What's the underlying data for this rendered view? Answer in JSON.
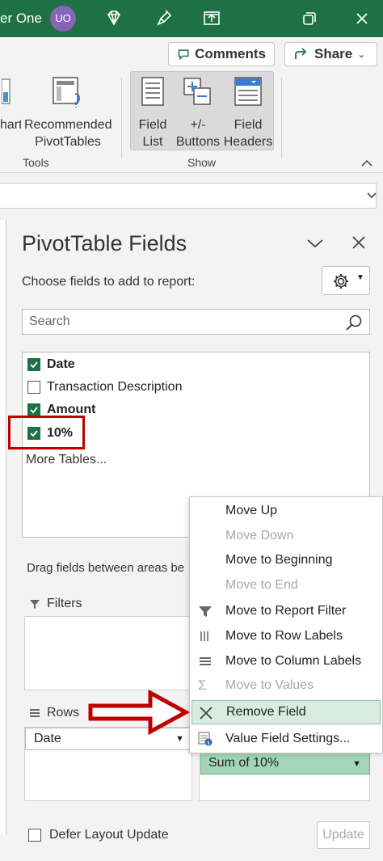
{
  "titlebar": {
    "user_name": "er One",
    "avatar_initials": "UO",
    "bg_color": "#1e7145"
  },
  "ribbon": {
    "comments_label": "Comments",
    "share_label": "Share",
    "chart_partial_label": "hart",
    "recommended_label_1": "Recommended",
    "recommended_label_2": "PivotTables",
    "field_list_label_1": "Field",
    "field_list_label_2": "List",
    "buttons_label_1": "+/-",
    "buttons_label_2": "Buttons",
    "field_headers_label_1": "Field",
    "field_headers_label_2": "Headers",
    "tools_group": "Tools",
    "show_group": "Show"
  },
  "pane": {
    "title": "PivotTable Fields",
    "subtitle": "Choose fields to add to report:",
    "search_placeholder": "Search",
    "fields": [
      {
        "name": "Date",
        "checked": true,
        "bold": true
      },
      {
        "name": "Transaction Description",
        "checked": false,
        "bold": false
      },
      {
        "name": "Amount",
        "checked": true,
        "bold": true
      },
      {
        "name": "10%",
        "checked": true,
        "bold": true
      }
    ],
    "more_tables": "More Tables...",
    "drag_text": "Drag fields between areas be",
    "filters_label": "Filters",
    "rows_label": "Rows",
    "rows_field": "Date",
    "values_field": "Sum of 10%",
    "defer_label": "Defer Layout Update",
    "update_label": "Update"
  },
  "context_menu": {
    "items": [
      {
        "label": "Move Up",
        "disabled": false
      },
      {
        "label": "Move Down",
        "disabled": true
      },
      {
        "label": "Move to Beginning",
        "disabled": false
      },
      {
        "label": "Move to End",
        "disabled": true
      },
      {
        "label": "Move to Report Filter",
        "disabled": false,
        "icon": "filter-icon"
      },
      {
        "label": "Move to Row Labels",
        "disabled": false,
        "icon": "row-labels-icon"
      },
      {
        "label": "Move to Column Labels",
        "disabled": false,
        "icon": "column-labels-icon"
      },
      {
        "label": "Move to Values",
        "disabled": true,
        "icon": "sigma-icon"
      },
      {
        "label": "Remove Field",
        "disabled": false,
        "highlighted": true,
        "icon": "remove-x-icon"
      },
      {
        "label": "Value Field Settings...",
        "disabled": false,
        "icon": "value-settings-icon"
      }
    ]
  },
  "colors": {
    "accent_green": "#1e7145",
    "annotation_red": "#c00000",
    "highlight": "#d7ebdf"
  }
}
